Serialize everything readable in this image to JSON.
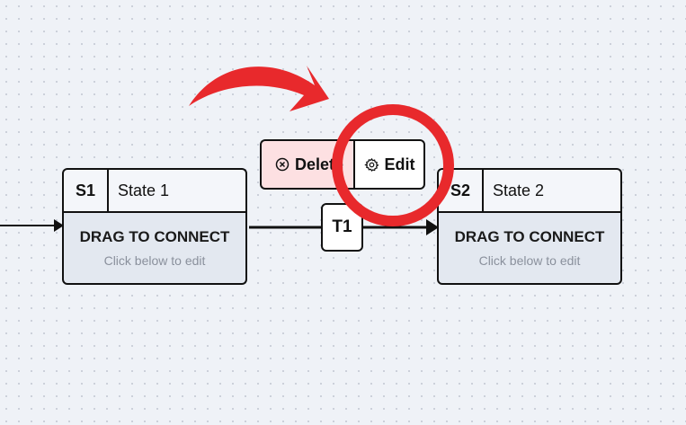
{
  "states": [
    {
      "id": "S1",
      "name": "State 1",
      "action": "DRAG TO CONNECT",
      "hint": "Click below to edit"
    },
    {
      "id": "S2",
      "name": "State 2",
      "action": "DRAG TO CONNECT",
      "hint": "Click below to edit"
    }
  ],
  "transition": {
    "label": "T1"
  },
  "toolbar": {
    "delete_label": "Delete",
    "edit_label": "Edit"
  },
  "icons": {
    "delete": "close-circle-icon",
    "edit": "gear-icon"
  },
  "colors": {
    "annotation_red": "#e8292c",
    "delete_bg": "#fde0e2",
    "node_body": "#e3e8f0"
  }
}
